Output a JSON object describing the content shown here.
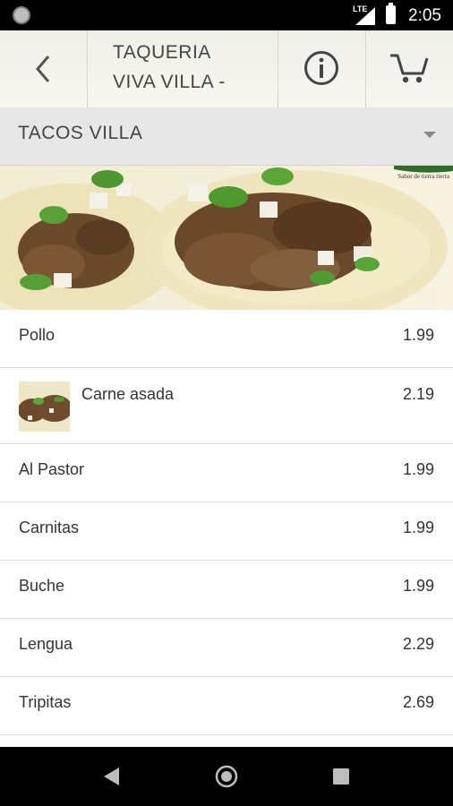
{
  "status_bar": {
    "network": "LTE",
    "time": "2:05"
  },
  "header": {
    "title_line1": "TAQUERIA",
    "title_line2": "VIVA VILLA -"
  },
  "category": {
    "selected": "TACOS VILLA"
  },
  "banner": {
    "tagline": "Sabor de tierra tierra"
  },
  "menu_items": [
    {
      "name": "Pollo",
      "price": "1.99"
    },
    {
      "name": "Carne asada",
      "price": "2.19"
    },
    {
      "name": "Al Pastor",
      "price": "1.99"
    },
    {
      "name": "Carnitas",
      "price": "1.99"
    },
    {
      "name": "Buche",
      "price": "1.99"
    },
    {
      "name": "Lengua",
      "price": "2.29"
    },
    {
      "name": "Tripitas",
      "price": "2.69"
    }
  ]
}
